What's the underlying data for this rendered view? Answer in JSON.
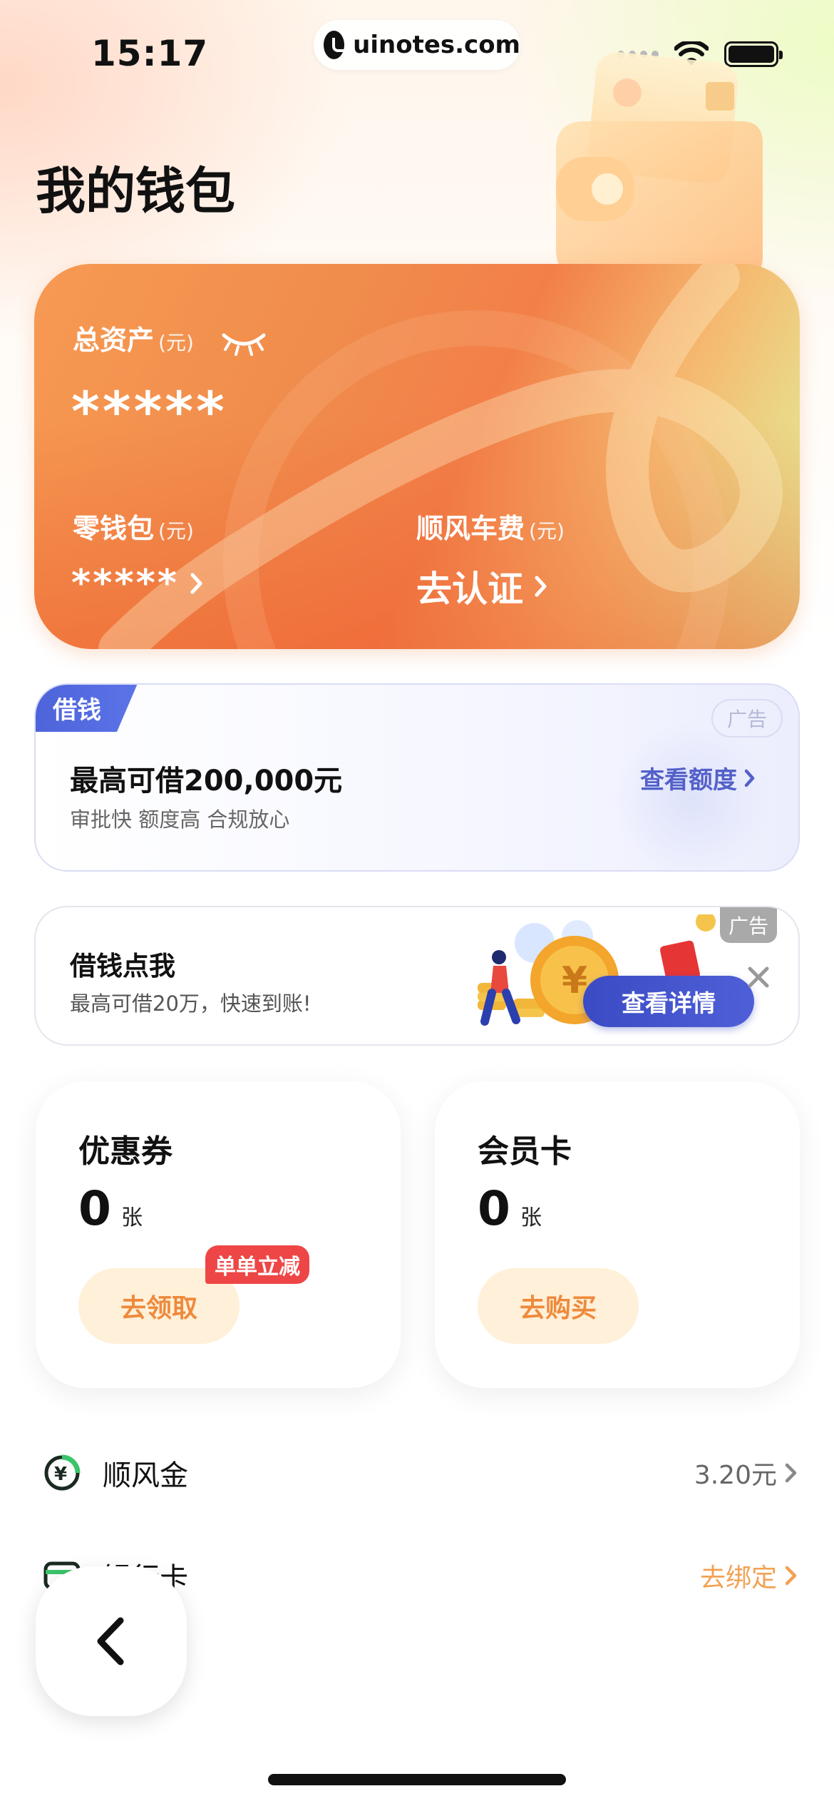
{
  "status_bar": {
    "time": "15:17",
    "url": "uinotes.com"
  },
  "page": {
    "title": "我的钱包"
  },
  "asset_card": {
    "total_label": "总资产",
    "total_unit": "(元)",
    "total_value": "*****",
    "pocket_label": "零钱包",
    "pocket_unit": "(元)",
    "pocket_value": "*****",
    "fare_label": "顺风车费",
    "fare_unit": "(元)",
    "fare_action": "去认证"
  },
  "loan_banner": {
    "tag": "借钱",
    "ad_label": "广告",
    "title": "最高可借200,000元",
    "subtitle": "审批快 额度高 合规放心",
    "link": "查看额度"
  },
  "borrow_ad": {
    "title": "借钱点我",
    "subtitle": "最高可借20万，快速到账!",
    "ad_label": "广告",
    "cta": "查看详情"
  },
  "coupon_card": {
    "title": "优惠券",
    "count": "0",
    "unit": "张",
    "button": "去领取",
    "badge": "单单立减"
  },
  "member_card": {
    "title": "会员卡",
    "count": "0",
    "unit": "张",
    "button": "去购买"
  },
  "list": [
    {
      "label": "顺风金",
      "value": "3.20元",
      "icon": "yuan-coin-icon"
    },
    {
      "label": "银行卡",
      "value": "去绑定",
      "icon": "bank-card-icon"
    }
  ],
  "colors": {
    "accent_orange": "#f08c4c",
    "loan_blue": "#5360c9",
    "promo_red": "#ee4646"
  }
}
